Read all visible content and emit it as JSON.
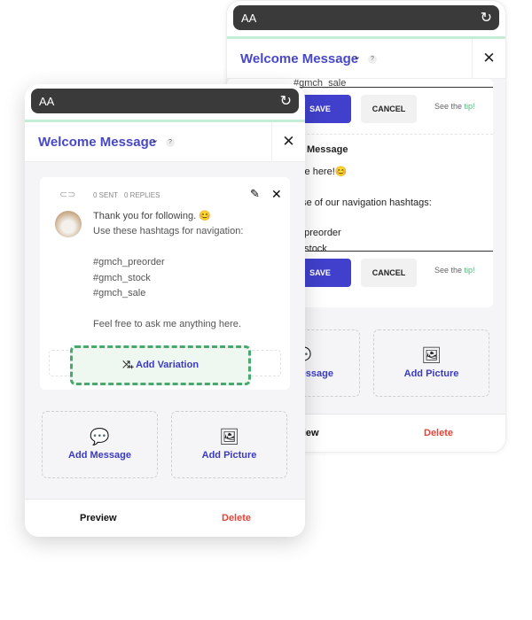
{
  "back": {
    "aa": "AA",
    "title": "Welcome Message",
    "help": "?",
    "hashtag_sale": "#gmch_sale",
    "save": "SAVE",
    "cancel": "CANCEL",
    "tip_prefix": "See the ",
    "tip_link": "tip!",
    "section": "Message",
    "line1": "Welcome here!😊",
    "line2": "Make use of our navigation hashtags:",
    "line3": "#gmch_preorder",
    "line4": "#gmch_stock",
    "add_message": "Add Message",
    "add_picture": "Add Picture",
    "preview": "Preview",
    "delete": "Delete"
  },
  "front": {
    "aa": "AA",
    "title": "Welcome Message",
    "help": "?",
    "sent": "0 SENT",
    "replies": "0 REPLIES",
    "message": [
      "Thank you for following. 😊",
      "Use these hashtags for navigation:",
      "#gmch_preorder",
      "#gmch_stock",
      "#gmch_sale",
      "Feel free to ask me anything here."
    ],
    "add_variation": "Add Variation",
    "add_message": "Add Message",
    "add_picture": "Add Picture",
    "preview": "Preview",
    "delete": "Delete"
  },
  "colors": {
    "accent": "#4747c8",
    "delete": "#e0453a",
    "highlight": "#4cb87a"
  }
}
